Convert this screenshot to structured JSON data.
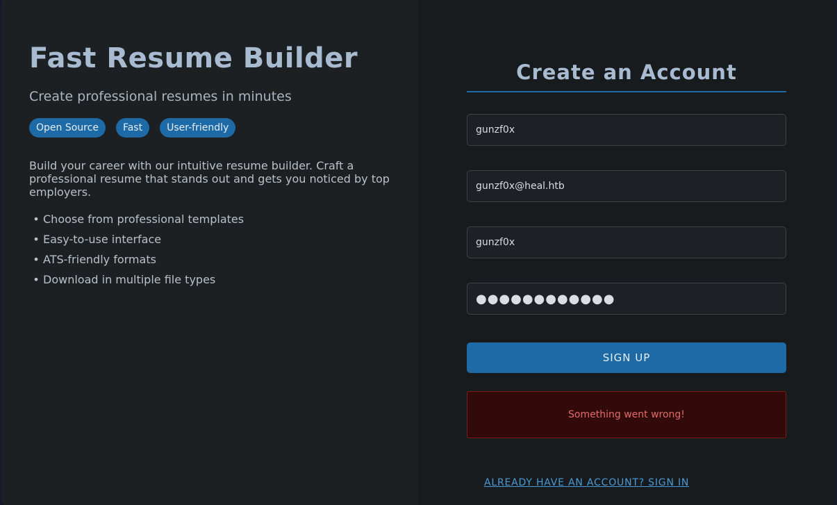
{
  "hero": {
    "title": "Fast Resume Builder",
    "subtitle": "Create professional resumes in minutes",
    "badges": [
      "Open Source",
      "Fast",
      "User-friendly"
    ],
    "description": "Build your career with our intuitive resume builder. Craft a professional resume that stands out and gets you noticed by top employers.",
    "features": [
      "Choose from professional templates",
      "Easy-to-use interface",
      "ATS-friendly formats",
      "Download in multiple file types"
    ],
    "bullet_glyph": "•"
  },
  "form": {
    "title": "Create an Account",
    "fields": {
      "full_name": {
        "value": "gunzf0x"
      },
      "email": {
        "value": "gunzf0x@heal.htb"
      },
      "username": {
        "value": "gunzf0x"
      },
      "password": {
        "value": "●●●●●●●●●●●●"
      }
    },
    "submit_label": "SIGN UP",
    "error_message": "Something went wrong!",
    "signin_link": "ALREADY HAVE AN ACCOUNT? SIGN IN"
  },
  "colors": {
    "accent": "#1d6aa6",
    "error_bg": "#330a0a",
    "error_text": "#e26a6a",
    "link": "#4a9ad6"
  }
}
